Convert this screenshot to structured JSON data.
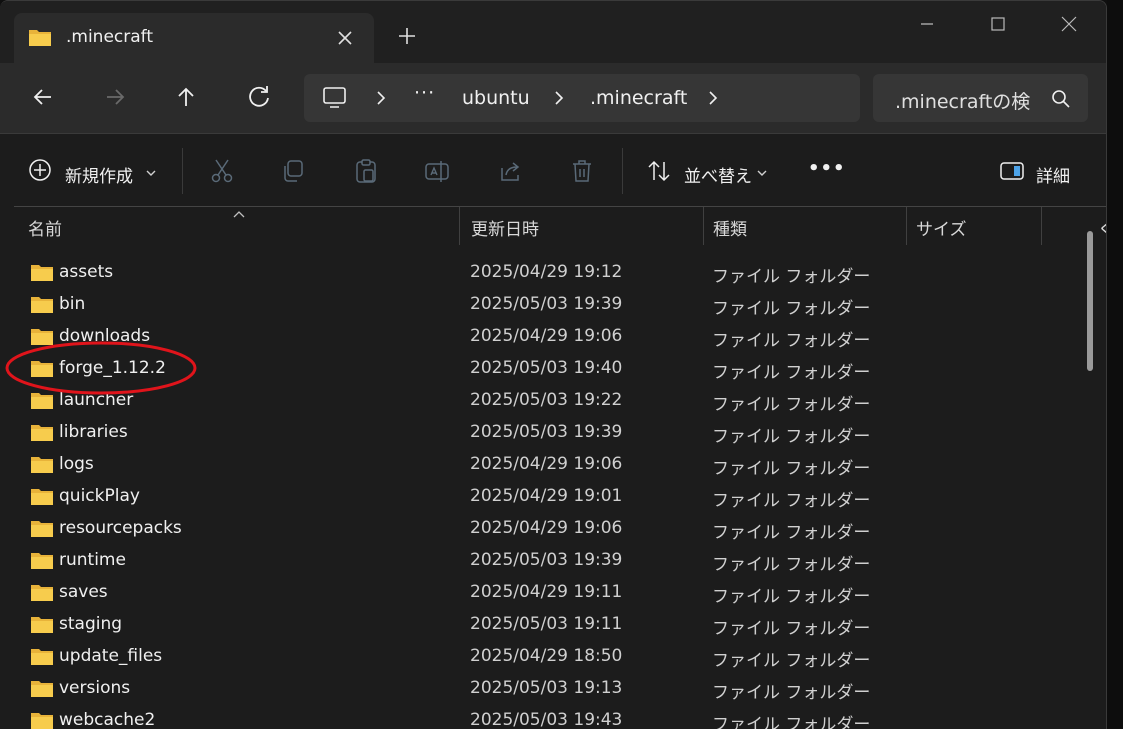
{
  "window": {
    "tab_title": ".minecraft",
    "icons": {
      "folder": "folder-icon",
      "close": "close-icon",
      "new_tab": "plus-icon",
      "minimize": "minimize-icon",
      "maximize": "maximize-icon",
      "window_close": "close-icon"
    }
  },
  "toolbar": {
    "address": {
      "segments": [
        "ubuntu",
        ".minecraft"
      ],
      "ellipsis": "···"
    },
    "search_placeholder": ".minecraftの検"
  },
  "commandbar": {
    "new_label": "新規作成",
    "sort_label": "並べ替え",
    "more_label": "•••",
    "details_label": "詳細"
  },
  "columns": {
    "name": "名前",
    "date": "更新日時",
    "type": "種類",
    "size": "サイズ",
    "extra": "ぐ"
  },
  "files": [
    {
      "name": "assets",
      "date": "2025/04/29 19:12",
      "type": "ファイル フォルダー"
    },
    {
      "name": "bin",
      "date": "2025/05/03 19:39",
      "type": "ファイル フォルダー"
    },
    {
      "name": "downloads",
      "date": "2025/04/29 19:06",
      "type": "ファイル フォルダー"
    },
    {
      "name": "forge_1.12.2",
      "date": "2025/05/03 19:40",
      "type": "ファイル フォルダー"
    },
    {
      "name": "launcher",
      "date": "2025/05/03 19:22",
      "type": "ファイル フォルダー"
    },
    {
      "name": "libraries",
      "date": "2025/05/03 19:39",
      "type": "ファイル フォルダー"
    },
    {
      "name": "logs",
      "date": "2025/04/29 19:06",
      "type": "ファイル フォルダー"
    },
    {
      "name": "quickPlay",
      "date": "2025/04/29 19:01",
      "type": "ファイル フォルダー"
    },
    {
      "name": "resourcepacks",
      "date": "2025/04/29 19:06",
      "type": "ファイル フォルダー"
    },
    {
      "name": "runtime",
      "date": "2025/05/03 19:39",
      "type": "ファイル フォルダー"
    },
    {
      "name": "saves",
      "date": "2025/04/29 19:11",
      "type": "ファイル フォルダー"
    },
    {
      "name": "staging",
      "date": "2025/05/03 19:11",
      "type": "ファイル フォルダー"
    },
    {
      "name": "update_files",
      "date": "2025/04/29 18:50",
      "type": "ファイル フォルダー"
    },
    {
      "name": "versions",
      "date": "2025/05/03 19:13",
      "type": "ファイル フォルダー"
    },
    {
      "name": "webcache2",
      "date": "2025/05/03 19:43",
      "type": "ファイル フォルダー"
    }
  ],
  "colors": {
    "folder": "#f5c542",
    "highlight": "#e0141b",
    "background": "#1c1c1c"
  }
}
